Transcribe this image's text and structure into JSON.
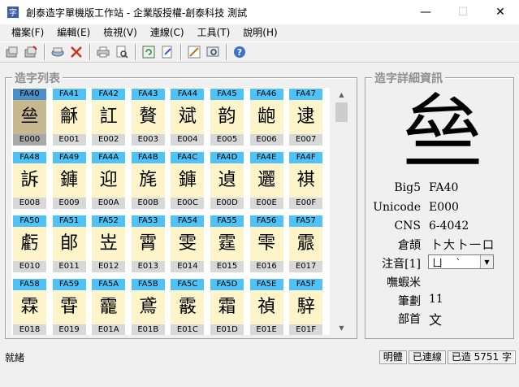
{
  "window": {
    "title": "創泰造字單機版工作站 - 企業版授權-創泰科技 測試",
    "minimize": "—",
    "maximize": "☐",
    "close": "✕"
  },
  "menu": [
    {
      "label": "檔案(F)"
    },
    {
      "label": "編輯(E)"
    },
    {
      "label": "檢視(V)"
    },
    {
      "label": "連線(C)"
    },
    {
      "label": "工具(T)"
    },
    {
      "label": "說明(H)"
    }
  ],
  "toolbar": {
    "icons": [
      "open-icon",
      "export-icon",
      "print-preview-icon",
      "delete-icon",
      "printer-icon",
      "preview-icon",
      "refresh-icon",
      "edit-icon",
      "design-icon",
      "search-window-icon",
      "help-icon"
    ]
  },
  "left_panel": {
    "legend": "造字列表"
  },
  "right_panel": {
    "legend": "造字詳細資訊"
  },
  "cells": [
    {
      "code": "FA40",
      "char": "亝",
      "uni": "E000"
    },
    {
      "code": "FA41",
      "char": "龢",
      "uni": "E001"
    },
    {
      "code": "FA42",
      "char": "訌",
      "uni": "E002"
    },
    {
      "code": "FA43",
      "char": "贅",
      "uni": "E003"
    },
    {
      "code": "FA44",
      "char": "斌",
      "uni": "E004"
    },
    {
      "code": "FA45",
      "char": "韵",
      "uni": "E005"
    },
    {
      "code": "FA46",
      "char": "龅",
      "uni": "E006"
    },
    {
      "code": "FA47",
      "char": "逮",
      "uni": "E007"
    },
    {
      "code": "FA48",
      "char": "訴",
      "uni": "E008"
    },
    {
      "code": "FA49",
      "char": "龲",
      "uni": "E009"
    },
    {
      "code": "FA4A",
      "char": "迎",
      "uni": "E00A"
    },
    {
      "code": "FA4B",
      "char": "旄",
      "uni": "E00B"
    },
    {
      "code": "FA4C",
      "char": "龲",
      "uni": "E00C"
    },
    {
      "code": "FA4D",
      "char": "遉",
      "uni": "E00D"
    },
    {
      "code": "FA4E",
      "char": "邐",
      "uni": "E00E"
    },
    {
      "code": "FA4F",
      "char": "褀",
      "uni": "E00F"
    },
    {
      "code": "FA50",
      "char": "虧",
      "uni": "E010"
    },
    {
      "code": "FA51",
      "char": "郋",
      "uni": "E011"
    },
    {
      "code": "FA52",
      "char": "岦",
      "uni": "E012"
    },
    {
      "code": "FA53",
      "char": "霄",
      "uni": "E013"
    },
    {
      "code": "FA54",
      "char": "雯",
      "uni": "E014"
    },
    {
      "code": "FA55",
      "char": "霆",
      "uni": "E015"
    },
    {
      "code": "FA56",
      "char": "雫",
      "uni": "E016"
    },
    {
      "code": "FA57",
      "char": "霢",
      "uni": "E017"
    },
    {
      "code": "FA58",
      "char": "霖",
      "uni": "E018"
    },
    {
      "code": "FA59",
      "char": "雸",
      "uni": "E019"
    },
    {
      "code": "FA5A",
      "char": "靇",
      "uni": "E01A"
    },
    {
      "code": "FA5B",
      "char": "鳶",
      "uni": "E01B"
    },
    {
      "code": "FA5C",
      "char": "霰",
      "uni": "E01C"
    },
    {
      "code": "FA5D",
      "char": "霜",
      "uni": "E01D"
    },
    {
      "code": "FA5E",
      "char": "禎",
      "uni": "E01E"
    },
    {
      "code": "FA5F",
      "char": "騂",
      "uni": "E01F"
    }
  ],
  "detail": {
    "big_char": "亝",
    "big5_label": "Big5",
    "big5_value": "FA40",
    "unicode_label": "Unicode",
    "unicode_value": "E000",
    "cns_label": "CNS",
    "cns_value": "6-4042",
    "cangjie_label": "倉頡",
    "cangjie_value": "卜大卜一口",
    "zhuyin_label": "注音[1]",
    "zhuyin_value": "ㄩ ˋ",
    "wubi_label": "嘸蝦米",
    "wubi_value": "",
    "strokes_label": "筆劃",
    "strokes_value": "11",
    "radical_label": "部首",
    "radical_value": "文"
  },
  "status": {
    "left": "就緒",
    "font": "明體",
    "connection": "已連線",
    "count": "已造 5751 字"
  },
  "colors": {
    "code_bg": "#4fc3f7",
    "char_bg": "#fdf5c9",
    "uni_bg": "#d8d8d8"
  }
}
